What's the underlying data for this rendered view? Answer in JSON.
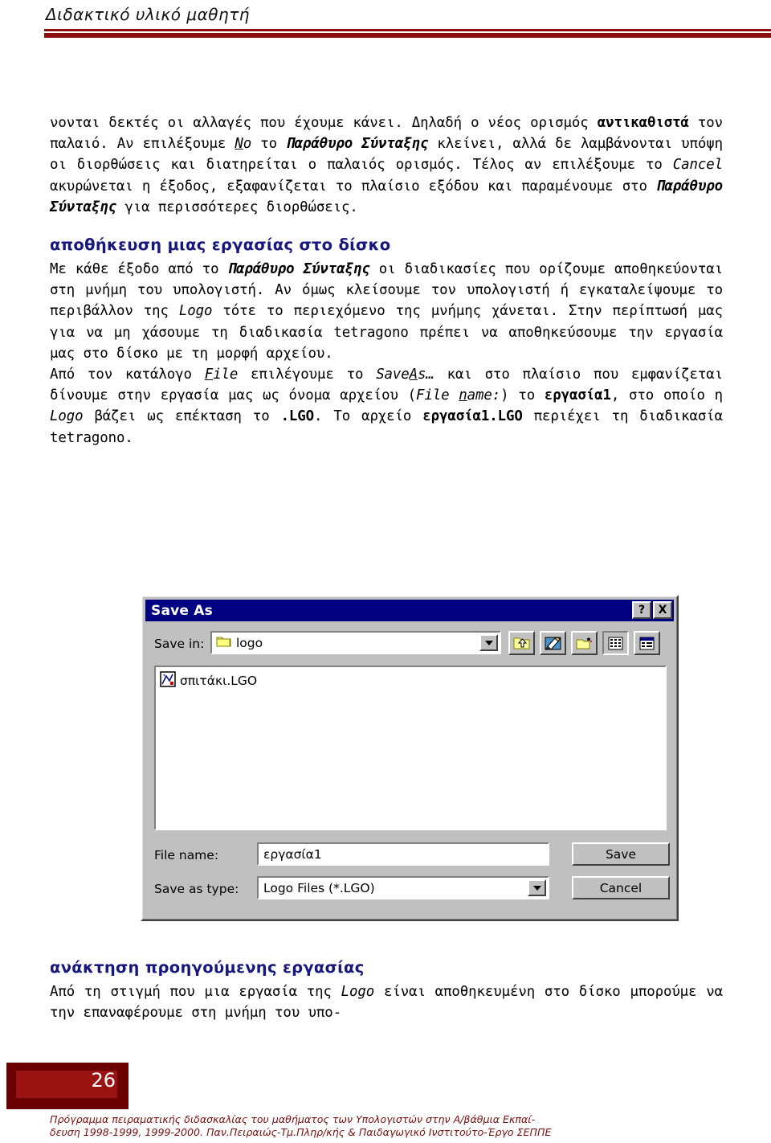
{
  "header": {
    "title": "Διδακτικό υλικό μαθητή"
  },
  "content": {
    "paragraph1_parts": [
      {
        "t": "νονται δεκτές οι αλλαγές που έχουμε κάνει. Δηλαδή ο νέος ορισμός ",
        "s": "normal"
      },
      {
        "t": "αντικαθιστά",
        "s": "bold"
      },
      {
        "t": " τον παλαιό. Αν επιλέξουμε ",
        "s": "normal"
      },
      {
        "t": "N",
        "s": "italic-underline"
      },
      {
        "t": "o",
        "s": "italic"
      },
      {
        "t": " το ",
        "s": "normal"
      },
      {
        "t": "Παράθυρο Σύνταξης",
        "s": "bold-italic"
      },
      {
        "t": " κλείνει, αλλά δε λαμβάνονται υπόψη οι διορθώσεις και διατηρείται ο παλαιός ορισμός. Τέλος αν επιλέξουμε το ",
        "s": "normal"
      },
      {
        "t": "Cancel",
        "s": "italic"
      },
      {
        "t": " ακυρώνεται η έξοδος, εξαφανίζεται το πλαίσιο εξόδου και παραμένουμε στο ",
        "s": "normal"
      },
      {
        "t": "Παράθυρο Σύνταξης",
        "s": "bold-italic"
      },
      {
        "t": " για περισσότερες διορθώσεις.",
        "s": "normal"
      }
    ],
    "heading1": "αποθήκευση μιας εργασίας στο δίσκο",
    "paragraph2_parts": [
      {
        "t": "Με κάθε έξοδο από το ",
        "s": "normal"
      },
      {
        "t": "Παράθυρο Σύνταξης",
        "s": "bold-italic"
      },
      {
        "t": " οι διαδικασίες που ορίζουμε αποθηκεύονται στη μνήμη του υπολογιστή. Αν όμως κλείσουμε τον υπολογιστή ή εγκαταλείψουμε το περιβάλλον της ",
        "s": "normal"
      },
      {
        "t": "Logo",
        "s": "italic"
      },
      {
        "t": " τότε το περιεχόμενο της μνήμης χάνεται. Στην περίπτωσή μας για να μη χάσουμε τη διαδικασία tetragono πρέπει να αποθηκεύσουμε την εργασία μας στο δίσκο με τη μορφή αρχείου.",
        "s": "normal"
      }
    ],
    "paragraph3_parts": [
      {
        "t": "Από τον κατάλογο ",
        "s": "normal"
      },
      {
        "t": "F",
        "s": "italic-underline"
      },
      {
        "t": "ile",
        "s": "italic"
      },
      {
        "t": " επιλέγουμε το ",
        "s": "normal"
      },
      {
        "t": "Save",
        "s": "italic"
      },
      {
        "t": "A",
        "s": "italic-underline"
      },
      {
        "t": "s…",
        "s": "italic"
      },
      {
        "t": " και στο πλαίσιο που εμφανίζεται δίνουμε στην εργασία μας ως όνομα αρχείου (",
        "s": "normal"
      },
      {
        "t": "File ",
        "s": "italic"
      },
      {
        "t": "n",
        "s": "italic-underline"
      },
      {
        "t": "ame:",
        "s": "italic"
      },
      {
        "t": ") το ",
        "s": "normal"
      },
      {
        "t": "εργασία1",
        "s": "bold"
      },
      {
        "t": ", στο οποίο η ",
        "s": "normal"
      },
      {
        "t": "Logo",
        "s": "italic"
      },
      {
        "t": " βάζει ως επέκταση το ",
        "s": "normal"
      },
      {
        "t": ".LGO",
        "s": "bold"
      },
      {
        "t": ". Το αρχείο ",
        "s": "normal"
      },
      {
        "t": "εργασία1.LGO",
        "s": "bold"
      },
      {
        "t": " περιέχει τη διαδικασία tetragono.",
        "s": "normal"
      }
    ],
    "heading2": "ανάκτηση προηγούμενης εργασίας",
    "paragraph4_parts": [
      {
        "t": "Από τη στιγμή που μια εργασία της ",
        "s": "normal"
      },
      {
        "t": "Logo",
        "s": "italic"
      },
      {
        "t": " είναι αποθηκευμένη στο δίσκο μπορούμε να την επαναφέρουμε στη μνήμη του υπο-",
        "s": "normal"
      }
    ]
  },
  "dialog": {
    "title": "Save As",
    "help_button": "?",
    "close_button": "X",
    "save_in_label": "Save in:",
    "save_in_value": "logo",
    "toolbar_icons": [
      "up-one-level-icon",
      "desktop-icon",
      "new-folder-icon",
      "list-view-icon",
      "details-view-icon"
    ],
    "files": [
      {
        "name": "σπιτάκι.LGO",
        "icon": "logo-file-icon"
      }
    ],
    "file_name_label": "File name:",
    "file_name_value": "εργασία1",
    "save_as_type_label": "Save as type:",
    "save_as_type_value": "Logo Files (*.LGO)",
    "save_button": "Save",
    "cancel_button": "Cancel"
  },
  "footer": {
    "page_number": "26",
    "note_line1": "Πρόγραμμα πειραματικής διδασκαλίας του μαθήματος των Υπολογιστών στην  Α/βάθμια Εκπαί-",
    "note_line2": "δευση 1998-1999, 1999-2000. Παν.Πειραιώς-Τμ.Πληρ/κής & Παιδαγωγικό Ινστιτούτο-Έργο ΣΕΠΠΕ"
  },
  "colors": {
    "rule_red": "#8b0f0f",
    "heading_blue": "#17177f",
    "footer_red": "#7a0f0f",
    "title_bar_blue": "#000080",
    "dialog_face": "#c0c0c0"
  }
}
